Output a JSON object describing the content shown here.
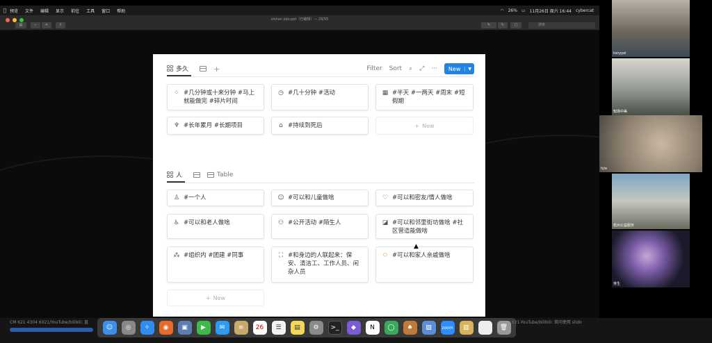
{
  "menubar": {
    "items": [
      "预览",
      "文件",
      "编辑",
      "显示",
      "前往",
      "工具",
      "窗口",
      "帮助"
    ],
    "battery": "26%",
    "datetime": "11月26日 周六 16:44",
    "user": "cybercat"
  },
  "window": {
    "title": "xishan jojo.ppt（已编辑）— 29/55",
    "search_placeholder": "搜索"
  },
  "board1": {
    "tab_label": "多久",
    "actions": {
      "filter": "Filter",
      "sort": "Sort",
      "more": "···",
      "new": "New"
    },
    "cards": [
      {
        "icon": "loading-icon",
        "glyph": "⁘",
        "text": "#几分钟或十来分钟 #马上就能做完 #碎片时间"
      },
      {
        "icon": "clock-icon",
        "glyph": "◷",
        "text": "#几十分钟 #活动"
      },
      {
        "icon": "calendar-icon",
        "glyph": "▦",
        "text": "#半天 #一两天 #周末 #短假期"
      },
      {
        "icon": "cactus-icon",
        "glyph": "♆",
        "text": "#长年累月 #长期项目"
      },
      {
        "icon": "tombstone-icon",
        "glyph": "⌂",
        "text": "#持续到死后"
      }
    ],
    "new_card_label": "New"
  },
  "board2": {
    "tab_label": "人",
    "tab_table_label": "Table",
    "cards": [
      {
        "icon": "person-icon",
        "glyph": "♙",
        "text": "#一个人"
      },
      {
        "icon": "smile-icon",
        "glyph": "☺",
        "text": "#可以和儿童做啥"
      },
      {
        "icon": "heart-icon",
        "glyph": "♡",
        "text": "#可以和密友/情人做啥"
      },
      {
        "icon": "cane-person-icon",
        "glyph": "♿",
        "text": "#可以和老人做啥"
      },
      {
        "icon": "group-icon",
        "glyph": "⚇",
        "text": "#公开活动 #陌生人"
      },
      {
        "icon": "shapes-icon",
        "glyph": "◪",
        "text": "#可以和邻里街坊做啥 #社区营造能做啥"
      },
      {
        "icon": "hierarchy-icon",
        "glyph": "⁂",
        "text": "#组织内 #团建 #同事"
      },
      {
        "icon": "scan-icon",
        "glyph": "⛶",
        "text": "#和身边的人联起来：保安、清洁工、工作人员、闲杂人员"
      },
      {
        "icon": "family-icon",
        "glyph": "ꖴ",
        "text": "#可以和家人亲戚做啥"
      }
    ],
    "new_card_label": "New"
  },
  "participants": [
    "tonyyel",
    "知场中美",
    "hjie",
    "杭州公益服务",
    "芽生"
  ],
  "ticker_left": "CM 621 4304 6021/YouTube/bilibili: 直",
  "ticker_right": "621-YouTube/bilibili: 首问使用 slido",
  "dock": {
    "calendar_day": "26",
    "apps": [
      "finder",
      "launchpad",
      "safari",
      "firefox",
      "preview",
      "facetime",
      "messages",
      "notes",
      "calendar",
      "reminders",
      "stickies",
      "settings",
      "terminal",
      "app",
      "notion",
      "browser",
      "acorn",
      "photos",
      "zoom",
      "finder2",
      "blank",
      "trash"
    ]
  }
}
